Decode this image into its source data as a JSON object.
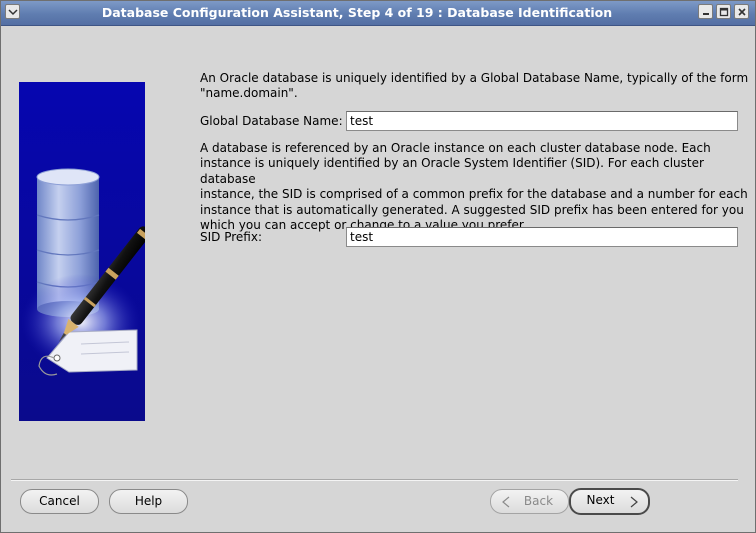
{
  "window": {
    "title": "Database Configuration Assistant, Step 4 of 19 : Database Identification"
  },
  "content": {
    "intro_text_line1": "An Oracle database is uniquely identified by a Global Database Name, typically of the form",
    "intro_text_line2": "\"name.domain\".",
    "global_db_name_label": "Global Database Name:",
    "global_db_name_value": "test",
    "sid_text_line1": "A database is referenced by an Oracle instance on each cluster database node. Each",
    "sid_text_line2": "instance is uniquely identified by an Oracle System Identifier (SID). For each cluster database",
    "sid_text_line3": "instance, the SID is comprised of a common prefix for the database and a number for each",
    "sid_text_line4": "instance that is automatically generated. A suggested SID prefix has been entered for you",
    "sid_text_line5": "which you can accept or change to a value you prefer.",
    "sid_prefix_label": "SID Prefix:",
    "sid_prefix_value": "test"
  },
  "buttons": {
    "cancel": "Cancel",
    "help": "Help",
    "back": "Back",
    "next": "Next"
  },
  "icons": {
    "window_menu": "chevron-down-icon",
    "minimize": "minimize-icon",
    "maximize": "maximize-icon",
    "close": "close-icon",
    "banner": "database-pen-icon"
  },
  "colors": {
    "titlebar": "#5f7db0",
    "banner_blue": "#0a0aa8",
    "background": "#d6d6d6"
  }
}
